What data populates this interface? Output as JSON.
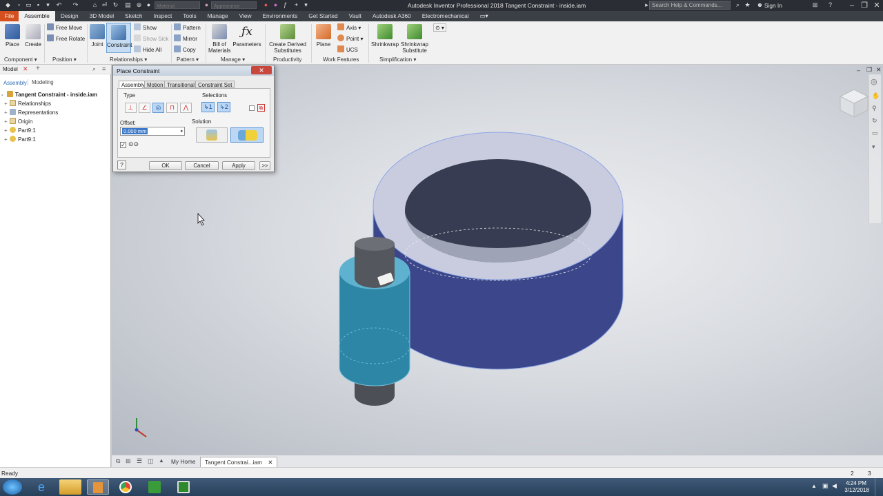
{
  "app": {
    "title": "Autodesk Inventor Professional 2018   Tangent Constraint - inside.iam",
    "search_placeholder": "Search Help & Commands...",
    "sign_in": "Sign In",
    "material_value": "Material",
    "appearance_value": "Appearance"
  },
  "menu": {
    "tabs": [
      "File",
      "Assemble",
      "Design",
      "3D Model",
      "Sketch",
      "Inspect",
      "Tools",
      "Manage",
      "View",
      "Environments",
      "Get Started",
      "Vault",
      "Autodesk A360",
      "Electromechanical"
    ],
    "active": "Assemble"
  },
  "ribbon": {
    "component": {
      "place": "Place",
      "create": "Create",
      "label": "Component"
    },
    "position": {
      "free_move": "Free Move",
      "free_rotate": "Free Rotate",
      "label": "Position"
    },
    "relationships": {
      "joint": "Joint",
      "constraint": "Constraint",
      "show": "Show",
      "show_sick": "Show Sick",
      "hide_all": "Hide All",
      "label": "Relationships"
    },
    "pattern": {
      "pattern": "Pattern",
      "mirror": "Mirror",
      "copy": "Copy",
      "label": "Pattern"
    },
    "manage": {
      "bom_line1": "Bill of",
      "bom_line2": "Materials",
      "parameters": "Parameters",
      "label": "Manage"
    },
    "productivity": {
      "cds_line1": "Create Derived",
      "cds_line2": "Substitutes",
      "label": "Productivity"
    },
    "work_features": {
      "plane": "Plane",
      "axis": "Axis",
      "point": "Point",
      "ucs": "UCS",
      "label": "Work Features"
    },
    "simplification": {
      "shrinkwrap": "Shrinkwrap",
      "sws_line1": "Shrinkwrap",
      "sws_line2": "Substitute",
      "label": "Simplification"
    }
  },
  "browser": {
    "tab_model": "Model",
    "sub_assembly": "Assembly",
    "sub_modeling": "Modeling",
    "root": "Tangent Constraint - inside.iam",
    "items": [
      "Relationships",
      "Representations",
      "Origin",
      "Part9:1",
      "Part9:1"
    ]
  },
  "dialog": {
    "title": "Place Constraint",
    "tabs": [
      "Assembly",
      "Motion",
      "Transitional",
      "Constraint Set"
    ],
    "type_label": "Type",
    "selections_label": "Selections",
    "offset_label": "Offset:",
    "offset_value": "0.000 mm",
    "solution_label": "Solution",
    "ok": "OK",
    "cancel": "Cancel",
    "apply": "Apply",
    "more": ">>"
  },
  "doc_tabs": {
    "home": "My Home",
    "active": "Tangent Constrai...iam"
  },
  "status": {
    "left": "Ready",
    "count1": "2",
    "count2": "3"
  },
  "taskbar": {
    "time": "4:24 PM",
    "date": "3/12/2018"
  },
  "colors": {
    "accent_file": "#d4501e",
    "ring": "#3c4a8c",
    "shaft": "#2e87a6",
    "selection": "#bcd7f3"
  }
}
